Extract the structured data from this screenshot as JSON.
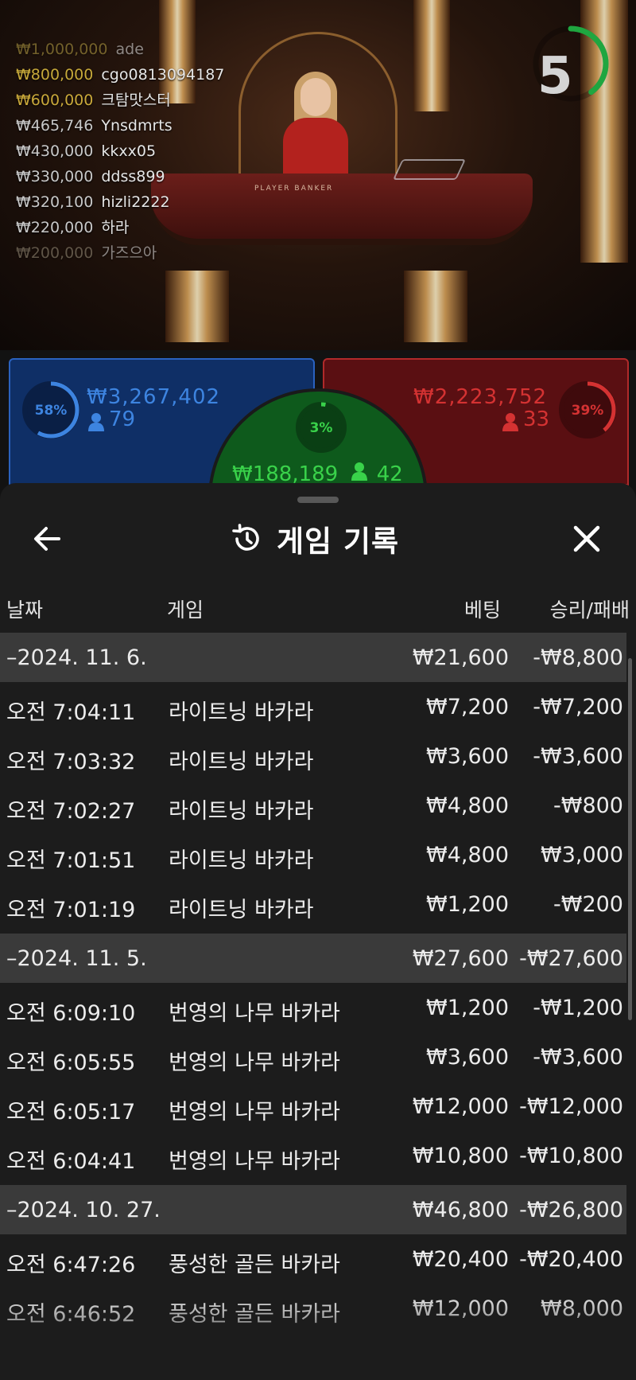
{
  "leaderboard": [
    {
      "amount": "₩1,000,000",
      "user": "ade"
    },
    {
      "amount": "₩800,000",
      "user": "cgo0813094187"
    },
    {
      "amount": "₩600,000",
      "user": "크탐맛스터"
    },
    {
      "amount": "₩465,746",
      "user": "Ynsdmrts"
    },
    {
      "amount": "₩430,000",
      "user": "kkxx05"
    },
    {
      "amount": "₩330,000",
      "user": "ddss899"
    },
    {
      "amount": "₩320,100",
      "user": "hizli2222"
    },
    {
      "amount": "₩220,000",
      "user": "하라"
    },
    {
      "amount": "₩200,000",
      "user": "가즈으아"
    }
  ],
  "leaderboard_colors": [
    "#b9a245",
    "#c7a93a",
    "#c9a83a",
    "#c8c8c8",
    "#c8c8c8",
    "#c8c8c8",
    "#c8c8c8",
    "#c8c8c8",
    "#9a8f7a"
  ],
  "timer": {
    "value": "5",
    "color": "#1fa640",
    "fraction": 0.4
  },
  "table_text": "PLAYER     BANKER",
  "player": {
    "percent": "58%",
    "percent_value": 0.58,
    "amount": "₩3,267,402",
    "count": "79",
    "color": "#3d84e0"
  },
  "banker": {
    "percent": "39%",
    "percent_value": 0.39,
    "amount": "₩2,223,752",
    "count": "33",
    "color": "#d43232"
  },
  "tie": {
    "percent": "3%",
    "percent_value": 0.03,
    "amount": "₩188,189",
    "count": "42",
    "color": "#39d24a"
  },
  "panel": {
    "title": "게임 기록",
    "back_icon": "arrow-left-icon",
    "history_icon": "history-icon",
    "close_icon": "close-icon"
  },
  "columns": {
    "date": "날짜",
    "game": "게임",
    "bet": "베팅",
    "result": "승리/패배"
  },
  "groups": [
    {
      "date": "–2024. 11. 6.",
      "bet": "₩21,600",
      "result": "-₩8,800",
      "rows": [
        {
          "time": "오전 7:04:11",
          "game": "라이트닝 바카라",
          "bet": "₩7,200",
          "result": "-₩7,200"
        },
        {
          "time": "오전 7:03:32",
          "game": "라이트닝 바카라",
          "bet": "₩3,600",
          "result": "-₩3,600"
        },
        {
          "time": "오전 7:02:27",
          "game": "라이트닝 바카라",
          "bet": "₩4,800",
          "result": "-₩800"
        },
        {
          "time": "오전 7:01:51",
          "game": "라이트닝 바카라",
          "bet": "₩4,800",
          "result": "₩3,000"
        },
        {
          "time": "오전 7:01:19",
          "game": "라이트닝 바카라",
          "bet": "₩1,200",
          "result": "-₩200"
        }
      ]
    },
    {
      "date": "–2024. 11. 5.",
      "bet": "₩27,600",
      "result": "-₩27,600",
      "rows": [
        {
          "time": "오전 6:09:10",
          "game": "번영의 나무 바카라",
          "bet": "₩1,200",
          "result": "-₩1,200"
        },
        {
          "time": "오전 6:05:55",
          "game": "번영의 나무 바카라",
          "bet": "₩3,600",
          "result": "-₩3,600"
        },
        {
          "time": "오전 6:05:17",
          "game": "번영의 나무 바카라",
          "bet": "₩12,000",
          "result": "-₩12,000"
        },
        {
          "time": "오전 6:04:41",
          "game": "번영의 나무 바카라",
          "bet": "₩10,800",
          "result": "-₩10,800"
        }
      ]
    },
    {
      "date": "–2024. 10. 27.",
      "bet": "₩46,800",
      "result": "-₩26,800",
      "rows": [
        {
          "time": "오전 6:47:26",
          "game": "풍성한 골든 바카라",
          "bet": "₩20,400",
          "result": "-₩20,400"
        },
        {
          "time": "오전 6:46:52",
          "game": "풍성한 골든 바카라",
          "bet": "₩12,000",
          "result": "₩8,000"
        }
      ]
    }
  ]
}
